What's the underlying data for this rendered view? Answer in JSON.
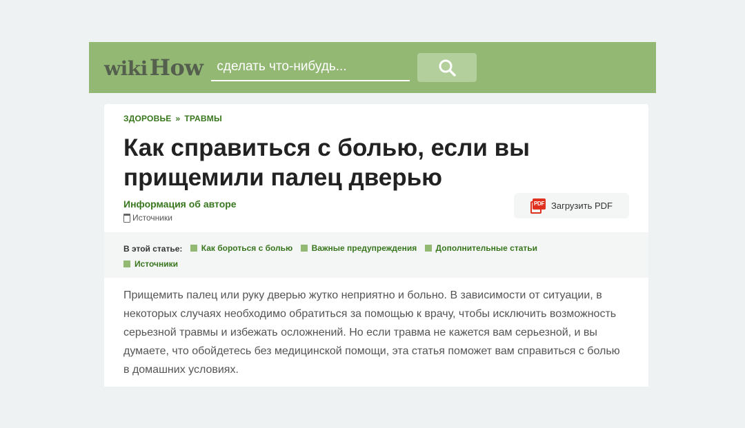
{
  "header": {
    "logo_wiki": "wiki",
    "logo_how": "How",
    "search_placeholder": "сделать что-нибудь...",
    "search_icon": "magnifier-icon",
    "background_color": "#93b874"
  },
  "breadcrumb": {
    "items": [
      "ЗДОРОВЬЕ",
      "ТРАВМЫ"
    ],
    "separator": "»"
  },
  "article": {
    "title": "Как справиться с болью, если вы прищемили палец дверью",
    "author_link": "Информация об авторе",
    "sources_link": "Источники",
    "pdf_button": "Загрузить PDF",
    "pdf_icon_text": "PDF",
    "toc_label": "В этой статье:",
    "toc_items": [
      "Как бороться с болью",
      "Важные предупреждения",
      "Дополнительные статьи",
      "Источники"
    ],
    "intro": "Прищемить палец или руку дверью жутко неприятно и больно. В зависимости от ситуации, в некоторых случаях необходимо обратиться за помощью к врачу, чтобы исключить возможность серьезной травмы и избежать осложнений. Но если травма не кажется вам серьезной, и вы думаете, что обойдетесь без медицинской помощи, эта статья поможет вам справиться с болью в домашних условиях."
  },
  "colors": {
    "accent_green": "#38761d",
    "page_bg": "#eff2f2"
  }
}
